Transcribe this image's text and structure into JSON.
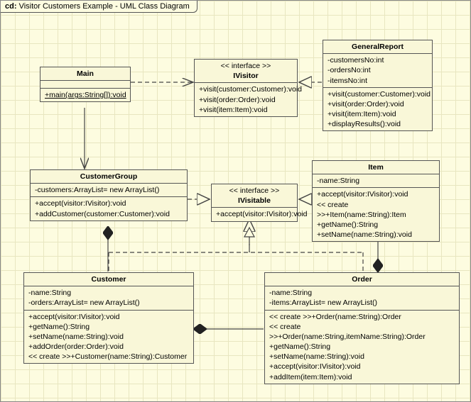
{
  "diagram": {
    "title_prefix": "cd:",
    "title": "Visitor Customers Example - UML Class Diagram"
  },
  "classes": {
    "Main": {
      "name": "Main",
      "ops": [
        "+main(args:String[]):void"
      ]
    },
    "IVisitor": {
      "stereotype": "<< interface >>",
      "name": "IVisitor",
      "ops": [
        "+visit(customer:Customer):void",
        "+visit(order:Order):void",
        "+visit(item:Item):void"
      ]
    },
    "GeneralReport": {
      "name": "GeneralReport",
      "attrs": [
        "-customersNo:int",
        "-ordersNo:int",
        "-itemsNo:int"
      ],
      "ops": [
        "+visit(customer:Customer):void",
        "+visit(order:Order):void",
        "+visit(item:Item):void",
        "+displayResults():void"
      ]
    },
    "CustomerGroup": {
      "name": "CustomerGroup",
      "attrs": [
        "-customers:ArrayList= new ArrayList()"
      ],
      "ops": [
        "+accept(visitor:IVisitor):void",
        "+addCustomer(customer:Customer):void"
      ]
    },
    "IVisitable": {
      "stereotype": "<< interface >>",
      "name": "IVisitable",
      "ops": [
        "+accept(visitor:IVisitor):void"
      ]
    },
    "Item": {
      "name": "Item",
      "attrs": [
        "-name:String"
      ],
      "ops": [
        "+accept(visitor:IVisitor):void",
        "<< create >>+Item(name:String):Item",
        "+getName():String",
        "+setName(name:String):void"
      ]
    },
    "Customer": {
      "name": "Customer",
      "attrs": [
        "-name:String",
        "-orders:ArrayList= new ArrayList()"
      ],
      "ops": [
        "+accept(visitor:IVisitor):void",
        "+getName():String",
        "+setName(name:String):void",
        "+addOrder(order:Order):void",
        "<< create >>+Customer(name:String):Customer"
      ]
    },
    "Order": {
      "name": "Order",
      "attrs": [
        "-name:String",
        "-items:ArrayList= new ArrayList()"
      ],
      "ops": [
        "<< create >>+Order(name:String):Order",
        "<< create >>+Order(name:String,itemName:String):Order",
        "+getName():String",
        "+setName(name:String):void",
        "+accept(visitor:IVisitor):void",
        "+addItem(item:Item):void"
      ]
    }
  },
  "chart_data": {
    "type": "diagram",
    "kind": "uml-class",
    "title": "Visitor Customers Example - UML Class Diagram",
    "classes": [
      {
        "name": "Main",
        "operations": [
          "+main(args:String[]):void"
        ],
        "static_ops": [
          "main"
        ]
      },
      {
        "name": "IVisitor",
        "stereotype": "interface",
        "operations": [
          "+visit(customer:Customer):void",
          "+visit(order:Order):void",
          "+visit(item:Item):void"
        ]
      },
      {
        "name": "GeneralReport",
        "attributes": [
          "-customersNo:int",
          "-ordersNo:int",
          "-itemsNo:int"
        ],
        "operations": [
          "+visit(customer:Customer):void",
          "+visit(order:Order):void",
          "+visit(item:Item):void",
          "+displayResults():void"
        ]
      },
      {
        "name": "CustomerGroup",
        "attributes": [
          "-customers:ArrayList= new ArrayList()"
        ],
        "operations": [
          "+accept(visitor:IVisitor):void",
          "+addCustomer(customer:Customer):void"
        ]
      },
      {
        "name": "IVisitable",
        "stereotype": "interface",
        "operations": [
          "+accept(visitor:IVisitor):void"
        ]
      },
      {
        "name": "Item",
        "attributes": [
          "-name:String"
        ],
        "operations": [
          "+accept(visitor:IVisitor):void",
          "<< create >>+Item(name:String):Item",
          "+getName():String",
          "+setName(name:String):void"
        ]
      },
      {
        "name": "Customer",
        "attributes": [
          "-name:String",
          "-orders:ArrayList= new ArrayList()"
        ],
        "operations": [
          "+accept(visitor:IVisitor):void",
          "+getName():String",
          "+setName(name:String):void",
          "+addOrder(order:Order):void",
          "<< create >>+Customer(name:String):Customer"
        ]
      },
      {
        "name": "Order",
        "attributes": [
          "-name:String",
          "-items:ArrayList= new ArrayList()"
        ],
        "operations": [
          "<< create >>+Order(name:String):Order",
          "<< create >>+Order(name:String,itemName:String):Order",
          "+getName():String",
          "+setName(name:String):void",
          "+accept(visitor:IVisitor):void",
          "+addItem(item:Item):void"
        ]
      }
    ],
    "relationships": [
      {
        "from": "Main",
        "to": "IVisitor",
        "type": "dependency"
      },
      {
        "from": "GeneralReport",
        "to": "IVisitor",
        "type": "realization"
      },
      {
        "from": "Main",
        "to": "CustomerGroup",
        "type": "association"
      },
      {
        "from": "CustomerGroup",
        "to": "IVisitable",
        "type": "realization"
      },
      {
        "from": "Item",
        "to": "IVisitable",
        "type": "realization"
      },
      {
        "from": "Customer",
        "to": "IVisitable",
        "type": "realization"
      },
      {
        "from": "Order",
        "to": "IVisitable",
        "type": "realization"
      },
      {
        "from": "CustomerGroup",
        "to": "Customer",
        "type": "composition"
      },
      {
        "from": "Customer",
        "to": "Order",
        "type": "composition"
      },
      {
        "from": "Order",
        "to": "Item",
        "type": "composition"
      }
    ]
  }
}
